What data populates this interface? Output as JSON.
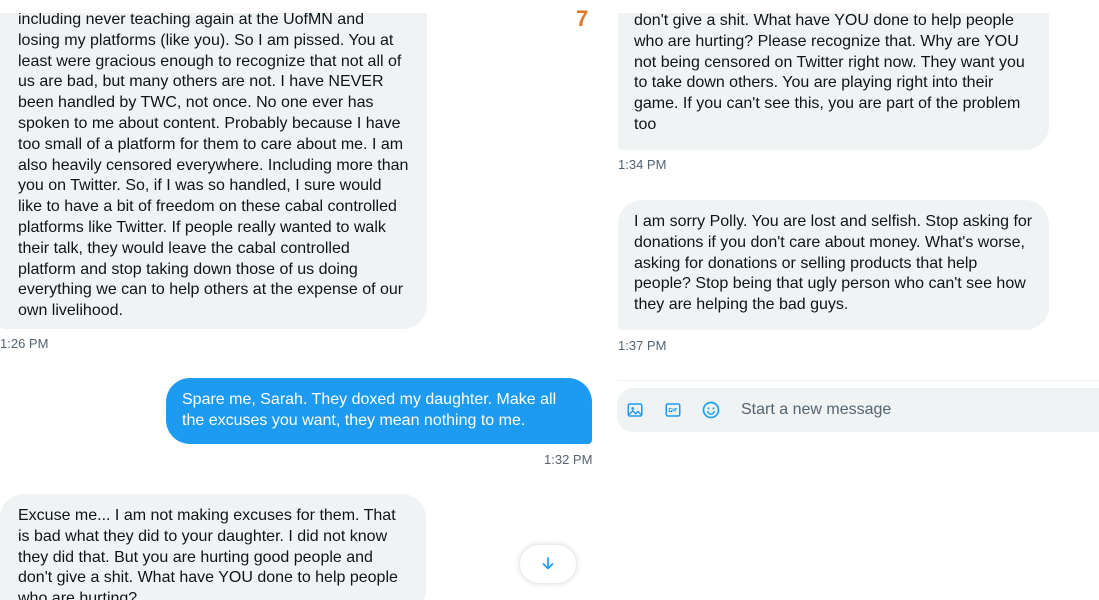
{
  "annotation_number": "7",
  "left_panel": {
    "messages": [
      {
        "text": "including never teaching again at the UofMN and losing my platforms (like you). So I am pissed. You at least were gracious enough to recognize that not all of us are bad, but many others are not. I have NEVER been handled by TWC, not once. No one ever has spoken to me about content. Probably because I have too small of a platform for them to care about me. I am also heavily censored everywhere. Including more than you on Twitter. So, if I was so handled, I sure would like to have a bit of freedom on these cabal controlled platforms like Twitter. If people really wanted to walk their talk, they would leave the cabal controlled platform and stop taking down those of us doing everything we can to help others at the expense of our own livelihood.",
        "time": "1:26 PM"
      },
      {
        "text": "Spare me, Sarah. They doxed my daughter. Make all the excuses you want, they mean nothing to me.",
        "time": "1:32 PM"
      },
      {
        "text": "Excuse me... I am not making excuses for them. That is bad what they did to your daughter. I did not know they did that. But you are hurting good people and don't give a shit. What have YOU done to help people who are hurting?"
      }
    ]
  },
  "right_panel": {
    "messages": [
      {
        "text": "don't give a shit. What have YOU done to help people who are hurting? Please recognize that. Why are YOU not being censored on Twitter right now. They want you to take down others. You are playing right into their game. If you can't see this, you are part of the problem too",
        "time": "1:34 PM"
      },
      {
        "text": "I am sorry Polly. You are lost and selfish. Stop asking for donations if you don't care about money. What's worse, asking for donations or selling products that help people? Stop being that ugly person who can't see how they are helping the bad guys.",
        "time": "1:37 PM"
      }
    ],
    "composer": {
      "placeholder": "Start a new message",
      "icons": [
        "image-icon",
        "gif-icon",
        "emoji-icon"
      ]
    }
  },
  "colors": {
    "accent": "#1d9bf0",
    "received_bubble": "#eff3f4",
    "timestamp": "#536471",
    "annotation": "#e0782a"
  }
}
